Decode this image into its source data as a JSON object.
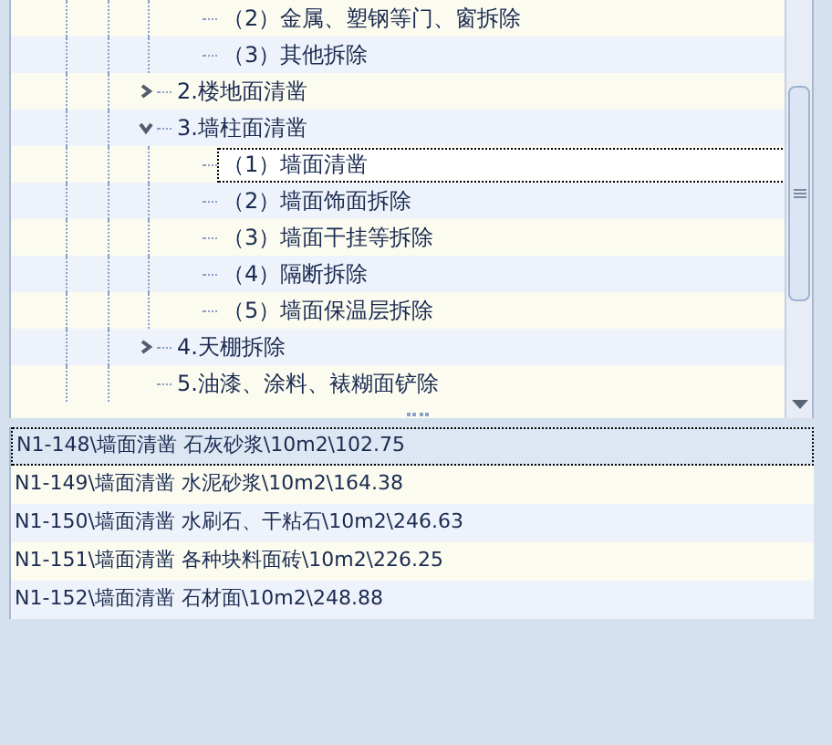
{
  "tree": {
    "items": [
      {
        "children": [
          {
            "label": "（2）金属、塑钢等门、窗拆除",
            "selected": false
          },
          {
            "label": "（3）其他拆除",
            "selected": false
          }
        ]
      },
      {
        "label": "2.楼地面清凿",
        "selected": false,
        "expanded": false
      },
      {
        "label": "3.墙柱面清凿",
        "selected": false,
        "expanded": true,
        "children": [
          {
            "label": "（1）墙面清凿",
            "selected": true
          },
          {
            "label": "（2）墙面饰面拆除",
            "selected": false
          },
          {
            "label": "（3）墙面干挂等拆除",
            "selected": false
          },
          {
            "label": "（4）隔断拆除",
            "selected": false
          },
          {
            "label": "（5）墙面保温层拆除",
            "selected": false
          }
        ]
      },
      {
        "label": "4.天棚拆除",
        "selected": false,
        "expanded": false
      },
      {
        "label": "5.油漆、涂料、裱糊面铲除",
        "selected": false
      }
    ]
  },
  "list": {
    "items": [
      {
        "label": "N1-148\\墙面清凿 石灰砂浆\\10m2\\102.75",
        "selected": true
      },
      {
        "label": "N1-149\\墙面清凿 水泥砂浆\\10m2\\164.38",
        "selected": false
      },
      {
        "label": "N1-150\\墙面清凿 水刷石、干粘石\\10m2\\246.63",
        "selected": false
      },
      {
        "label": "N1-151\\墙面清凿 各种块料面砖\\10m2\\226.25",
        "selected": false
      },
      {
        "label": "N1-152\\墙面清凿 石材面\\10m2\\248.88",
        "selected": false
      }
    ]
  }
}
